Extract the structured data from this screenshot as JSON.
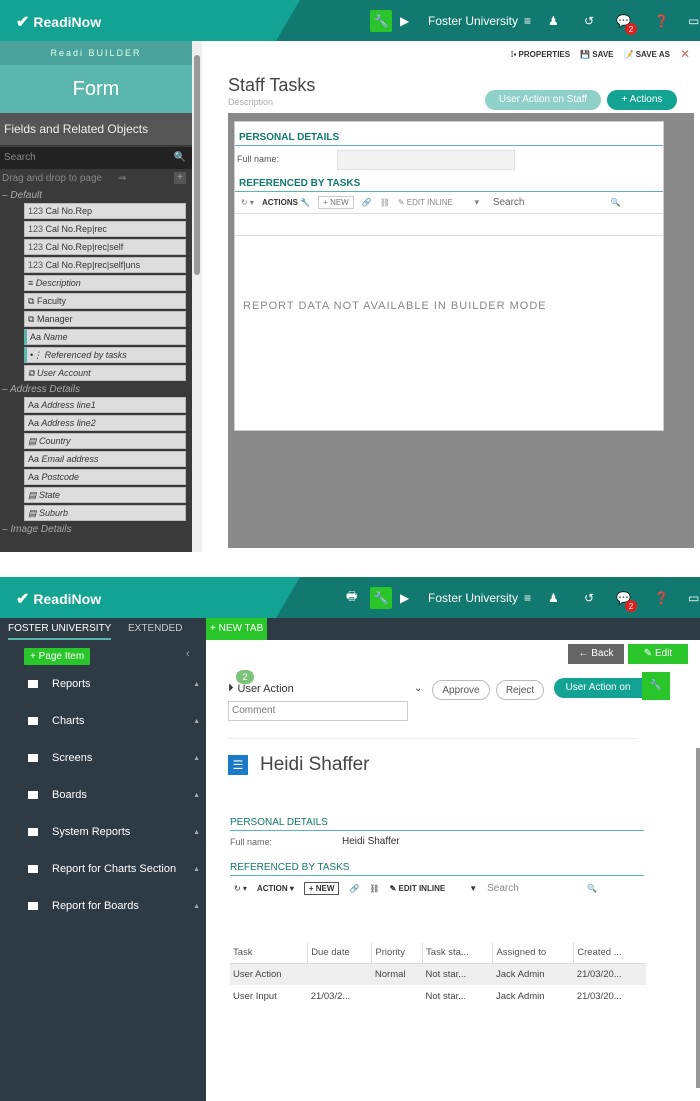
{
  "app": {
    "logo": "ReadiNow",
    "tenant": "Foster University",
    "messages_badge": "2"
  },
  "builder": {
    "header": "Readi BUILDER",
    "form_title": "Form",
    "fields_title": "Fields and Related Objects",
    "search_placeholder": "Search",
    "drag_hint": "Drag and drop to page",
    "groups": [
      {
        "name": "Default",
        "fields": [
          {
            "label": "Cal No.Rep",
            "icon": "123"
          },
          {
            "label": "Cal No.Rep|rec",
            "icon": "123"
          },
          {
            "label": "Cal No.Rep|rec|self",
            "icon": "123"
          },
          {
            "label": "Cal No.Rep|rec|self|uns",
            "icon": "123"
          },
          {
            "label": "Description",
            "icon": "multiline"
          },
          {
            "label": "Faculty",
            "icon": "lookup"
          },
          {
            "label": "Manager",
            "icon": "lookup"
          },
          {
            "label": "Name",
            "icon": "Aa"
          },
          {
            "label": "Referenced by tasks",
            "icon": "relationship"
          },
          {
            "label": "User Account",
            "icon": "lookup"
          }
        ]
      },
      {
        "name": "Address Details",
        "fields": [
          {
            "label": "Address line1",
            "icon": "Aa"
          },
          {
            "label": "Address line2",
            "icon": "Aa"
          },
          {
            "label": "Country",
            "icon": "choice"
          },
          {
            "label": "Email address",
            "icon": "Aa"
          },
          {
            "label": "Postcode",
            "icon": "Aa"
          },
          {
            "label": "State",
            "icon": "choice"
          },
          {
            "label": "Suburb",
            "icon": "choice"
          }
        ]
      },
      {
        "name": "Image Details",
        "fields": []
      }
    ],
    "toolbar": {
      "properties": "PROPERTIES",
      "save": "SAVE",
      "save_as": "SAVE AS"
    },
    "canvas": {
      "title": "Staff Tasks",
      "description": "Description",
      "user_action_pill": "User Action on Staff",
      "actions_pill": "+ Actions",
      "personal_details": "PERSONAL DETAILS",
      "full_name_label": "Full name:",
      "referenced_by_tasks": "REFERENCED BY TASKS",
      "actions_label": "ACTIONS",
      "new_label": "NEW",
      "edit_inline": "EDIT INLINE",
      "search": "Search",
      "no_data": "REPORT DATA NOT AVAILABLE IN BUILDER MODE"
    }
  },
  "runtime": {
    "tabs": [
      "FOSTER UNIVERSITY",
      "EXTENDED"
    ],
    "new_tab": "+ NEW TAB",
    "page_item": "+ Page Item",
    "nav": [
      "Reports",
      "Charts",
      "Screens",
      "Boards",
      "System Reports",
      "Report for Charts Section",
      "Report for Boards"
    ],
    "back": "Back",
    "edit": "Edit",
    "action_count": "2",
    "user_action": "User Action",
    "approve": "Approve",
    "reject": "Reject",
    "user_action_on": "User Action on",
    "comment_placeholder": "Comment",
    "record_title": "Heidi Shaffer",
    "personal_details": "PERSONAL DETAILS",
    "full_name_label": "Full name:",
    "full_name_value": "Heidi Shaffer",
    "referenced_by_tasks": "REFERENCED BY TASKS",
    "action_label": "ACTION",
    "new_label": "NEW",
    "edit_inline": "EDIT INLINE",
    "search": "Search",
    "columns": [
      "Task",
      "Due date",
      "Priority",
      "Task sta...",
      "Assigned to",
      "Created ..."
    ],
    "rows": [
      [
        "User Action",
        "",
        "Normal",
        "Not star...",
        "Jack Admin",
        "21/03/20..."
      ],
      [
        "User Input",
        "21/03/2...",
        "",
        "Not star...",
        "Jack Admin",
        "21/03/20..."
      ]
    ]
  },
  "colors": {
    "brand": "#11796f",
    "teal": "#5bb7ae",
    "green": "#2ac52a",
    "nav": "#2e3a44"
  }
}
